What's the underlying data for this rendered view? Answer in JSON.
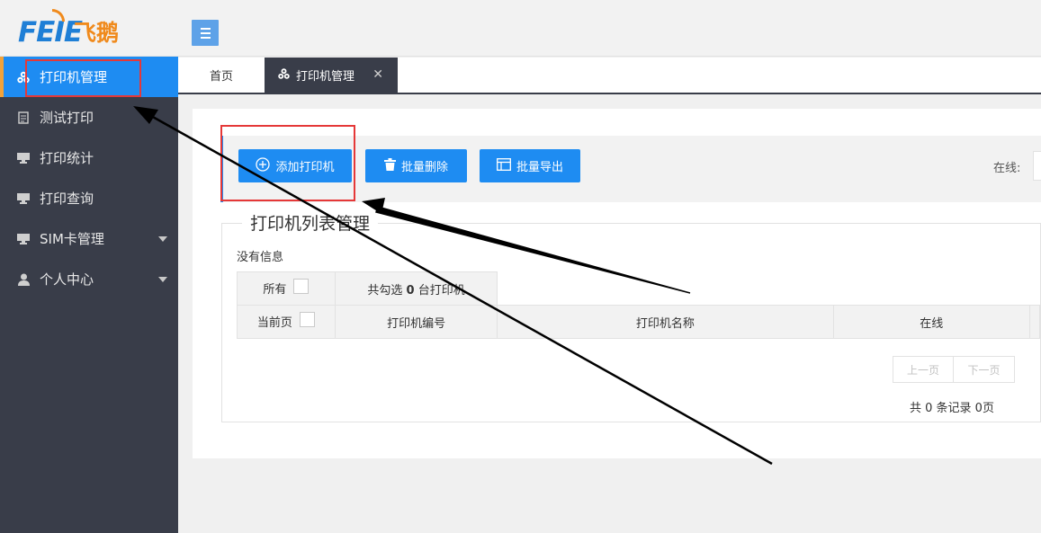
{
  "logo": {
    "text": "FEIE",
    "text_cn": "飞鹅"
  },
  "sidebar": {
    "items": [
      {
        "label": "打印机管理",
        "icon": "cubes-icon",
        "active": true
      },
      {
        "label": "测试打印",
        "icon": "document-icon"
      },
      {
        "label": "打印统计",
        "icon": "monitor-icon"
      },
      {
        "label": "打印查询",
        "icon": "monitor-icon"
      },
      {
        "label": "SIM卡管理",
        "icon": "monitor-icon",
        "expandable": true
      },
      {
        "label": "个人中心",
        "icon": "user-icon",
        "expandable": true
      }
    ]
  },
  "tabs": {
    "home": "首页",
    "active": "打印机管理",
    "close": "✕"
  },
  "toolbar": {
    "add": "添加打印机",
    "delete": "批量删除",
    "export": "批量导出",
    "online_label": "在线:"
  },
  "list": {
    "legend": "打印机列表管理",
    "no_info": "没有信息",
    "all_label": "所有",
    "selected_prefix": "共勾选",
    "selected_count": "0",
    "selected_suffix": "台打印机",
    "current_page_label": "当前页",
    "col_number": "打印机编号",
    "col_name": "打印机名称",
    "col_online": "在线"
  },
  "pager": {
    "prev": "上一页",
    "next": "下一页",
    "records": "共 0 条记录 0页"
  },
  "colors": {
    "accent": "#1e8cf2",
    "sidebar": "#393d49",
    "highlight": "#e53838"
  }
}
